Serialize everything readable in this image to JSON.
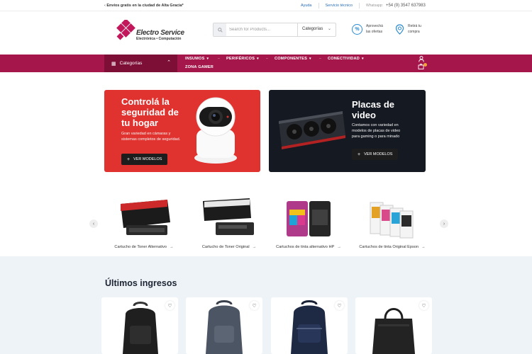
{
  "topbar": {
    "promo_prefix": "Envíos gratis en la ciudad de Alta Gracia*",
    "links": [
      "Ayuda",
      "Servicio técnico"
    ],
    "whatsapp_label": "Whatsapp:",
    "whatsapp_number": "+54 (9) 3547 637983"
  },
  "logo": {
    "brand": "Electro Service",
    "sub": "Electrónica • Computación"
  },
  "search": {
    "placeholder": "Search for Products...",
    "category": "Categorías"
  },
  "features": [
    {
      "line1": "Aprovechá",
      "line2": "las ofertas"
    },
    {
      "line1": "Retirá tu",
      "line2": "compra"
    }
  ],
  "nav": {
    "categories_label": "Categorías",
    "items": [
      "INSUMOS",
      "PERIFÉRICOS",
      "COMPONENTES",
      "CONECTIVIDAD",
      "ZONA GAMER"
    ]
  },
  "banners": [
    {
      "title_lines": [
        "Controlá la",
        "seguridad de",
        "tu hogar"
      ],
      "desc_lines": [
        "Gran variedad en cámaras y",
        "sistemas completos de seguridad."
      ],
      "button": "VER MODELOS"
    },
    {
      "title_lines": [
        "Placas de",
        "video"
      ],
      "desc_lines": [
        "Contamos con variedad en",
        "modelos de placas de video",
        "para gaming o para minado"
      ],
      "button": "VER MODELOS"
    }
  ],
  "products": [
    {
      "label": "Cartucho de Toner Alternativo"
    },
    {
      "label": "Cartucho de Toner Original"
    },
    {
      "label": "Cartuchos de tinta alternativo HP"
    },
    {
      "label": "Cartuchos de tinta Original Epson"
    }
  ],
  "latest": {
    "title": "Últimos ingresos"
  },
  "icons": {
    "search": "search-icon",
    "offers": "percent-icon",
    "pickup": "map-pin-icon",
    "grid": "grid-icon",
    "user": "user-icon",
    "cart": "cart-icon",
    "heart": "heart-icon"
  },
  "colors": {
    "nav": "#a5164a",
    "nav_dark": "#7d0e35",
    "banner_red": "#e0332f",
    "banner_dark": "#151922",
    "link": "#2a6fb5"
  }
}
